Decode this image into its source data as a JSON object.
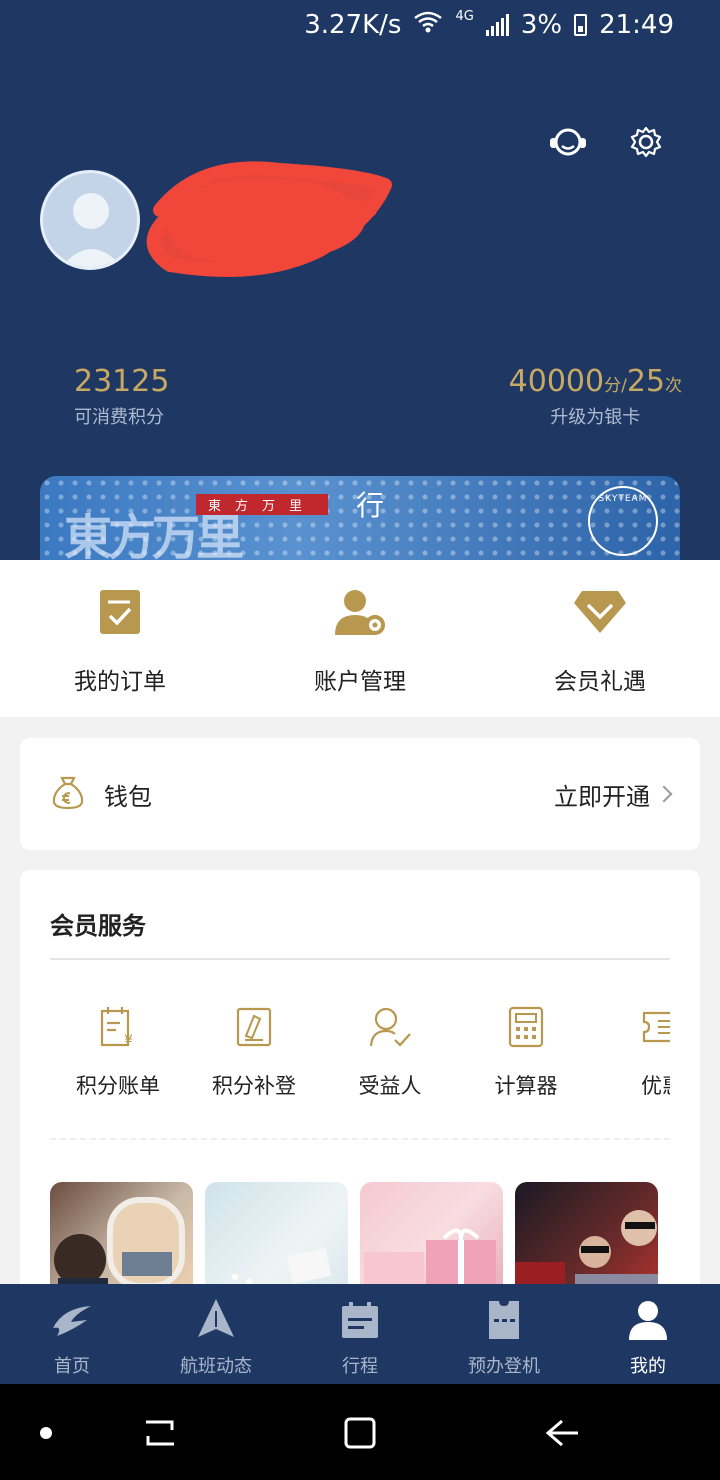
{
  "status_bar": {
    "speed": "3.27K/s",
    "network": "4G",
    "battery": "3%",
    "time": "21:49"
  },
  "header": {
    "support_icon": "customer-service-icon",
    "settings_icon": "gear-icon",
    "username_redacted": true
  },
  "stats": {
    "points_value": "23125",
    "points_label": "可消费积分",
    "upgrade_points": "40000",
    "upgrade_points_unit": "分/",
    "upgrade_times": "25",
    "upgrade_times_unit": "次",
    "upgrade_label": "升级为银卡"
  },
  "banner": {
    "tag": "東方万里",
    "script": "行",
    "partner": "SKYTEAM"
  },
  "quick_actions": [
    {
      "label": "我的订单",
      "icon": "order-icon"
    },
    {
      "label": "账户管理",
      "icon": "account-settings-icon"
    },
    {
      "label": "会员礼遇",
      "icon": "diamond-icon"
    }
  ],
  "wallet": {
    "label": "钱包",
    "action": "立即开通",
    "icon": "money-bag-icon"
  },
  "services": {
    "title": "会员服务",
    "items": [
      {
        "label": "积分账单",
        "icon": "points-bill-icon"
      },
      {
        "label": "积分补登",
        "icon": "points-claim-icon"
      },
      {
        "label": "受益人",
        "icon": "beneficiary-icon"
      },
      {
        "label": "计算器",
        "icon": "calculator-icon"
      },
      {
        "label": "优惠",
        "icon": "coupon-icon"
      }
    ]
  },
  "tabs": [
    {
      "label": "首页",
      "icon": "airline-logo-icon",
      "active": false
    },
    {
      "label": "航班动态",
      "icon": "plane-icon",
      "active": false
    },
    {
      "label": "行程",
      "icon": "itinerary-icon",
      "active": false
    },
    {
      "label": "预办登机",
      "icon": "boarding-pass-icon",
      "active": false
    },
    {
      "label": "我的",
      "icon": "profile-icon",
      "active": true
    }
  ],
  "colors": {
    "navy": "#1e3863",
    "gold": "#c8a964",
    "accent_gold": "#b8984f"
  }
}
